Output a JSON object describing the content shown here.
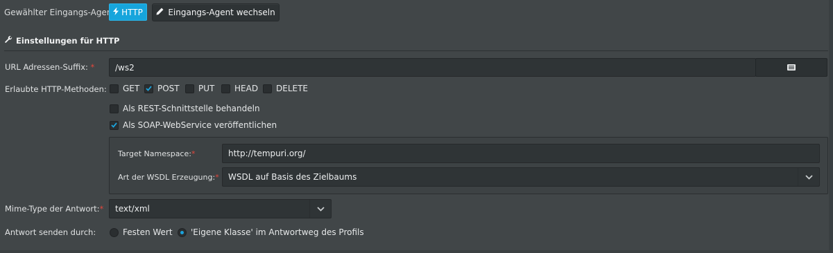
{
  "topbar": {
    "label": "Gewählter Eingangs-Agent:",
    "http_button": "HTTP",
    "switch_button": "Eingangs-Agent wechseln"
  },
  "section": {
    "title": "Einstellungen für HTTP"
  },
  "url_suffix": {
    "label": "URL Adressen-Suffix:",
    "required": "*",
    "value": "/ws2"
  },
  "methods": {
    "label": "Erlaubte HTTP-Methoden:",
    "items": [
      {
        "label": "GET",
        "checked": false
      },
      {
        "label": "POST",
        "checked": true
      },
      {
        "label": "PUT",
        "checked": false
      },
      {
        "label": "HEAD",
        "checked": false
      },
      {
        "label": "DELETE",
        "checked": false
      }
    ]
  },
  "options": {
    "rest": {
      "label": "Als REST-Schnittstelle behandeln",
      "checked": false
    },
    "soap": {
      "label": "Als SOAP-WebService veröffentlichen",
      "checked": true
    }
  },
  "soap_panel": {
    "namespace_label": "Target Namespace:",
    "namespace_value": "http://tempuri.org/",
    "wsdl_label": "Art der WSDL Erzeugung:",
    "wsdl_value": "WSDL auf Basis des Zielbaums",
    "required": "*"
  },
  "mime": {
    "label": "Mime-Type der Antwort:",
    "required": "*",
    "value": "text/xml"
  },
  "response": {
    "label": "Antwort senden durch:",
    "options": [
      {
        "label": "Festen Wert",
        "selected": false
      },
      {
        "label": "'Eigene Klasse' im Antwortweg des Profils",
        "selected": true
      }
    ]
  },
  "colors": {
    "accent": "#16a5dc",
    "required": "#e2473c",
    "background": "#414648"
  }
}
